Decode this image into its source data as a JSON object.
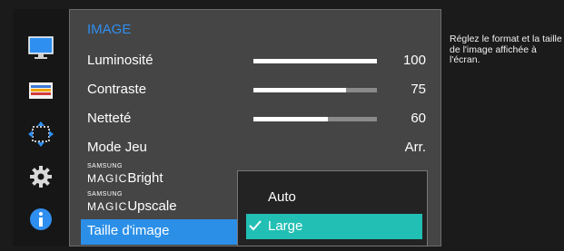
{
  "menu": {
    "title": "IMAGE",
    "items": [
      {
        "label": "Luminosité",
        "value": "100",
        "level": 100,
        "type": "slider"
      },
      {
        "label": "Contraste",
        "value": "75",
        "level": 75,
        "type": "slider"
      },
      {
        "label": "Netteté",
        "value": "60",
        "level": 60,
        "type": "slider"
      },
      {
        "label": "Mode Jeu",
        "value": "Arr.",
        "type": "value"
      },
      {
        "brand_top": "SAMSUNG",
        "brand_bottom": "MAGIC",
        "label": "Bright",
        "type": "submenu"
      },
      {
        "brand_top": "SAMSUNG",
        "brand_bottom": "MAGIC",
        "label": "Upscale",
        "type": "submenu"
      },
      {
        "label": "Taille d'image",
        "type": "selected"
      }
    ]
  },
  "submenu": {
    "options": [
      {
        "label": "Auto",
        "selected": false
      },
      {
        "label": "Large",
        "selected": true
      }
    ]
  },
  "help_text": "Réglez le format et la taille de l'image affichée à l'écran.",
  "sidebar_icons": [
    "picture-icon",
    "color-icon",
    "size-position-icon",
    "settings-icon",
    "information-icon"
  ],
  "colors": {
    "accent_blue": "#2b8fe8",
    "selected_option": "#22bfb4",
    "panel_bg": "#454545",
    "popup_bg": "#232323"
  }
}
